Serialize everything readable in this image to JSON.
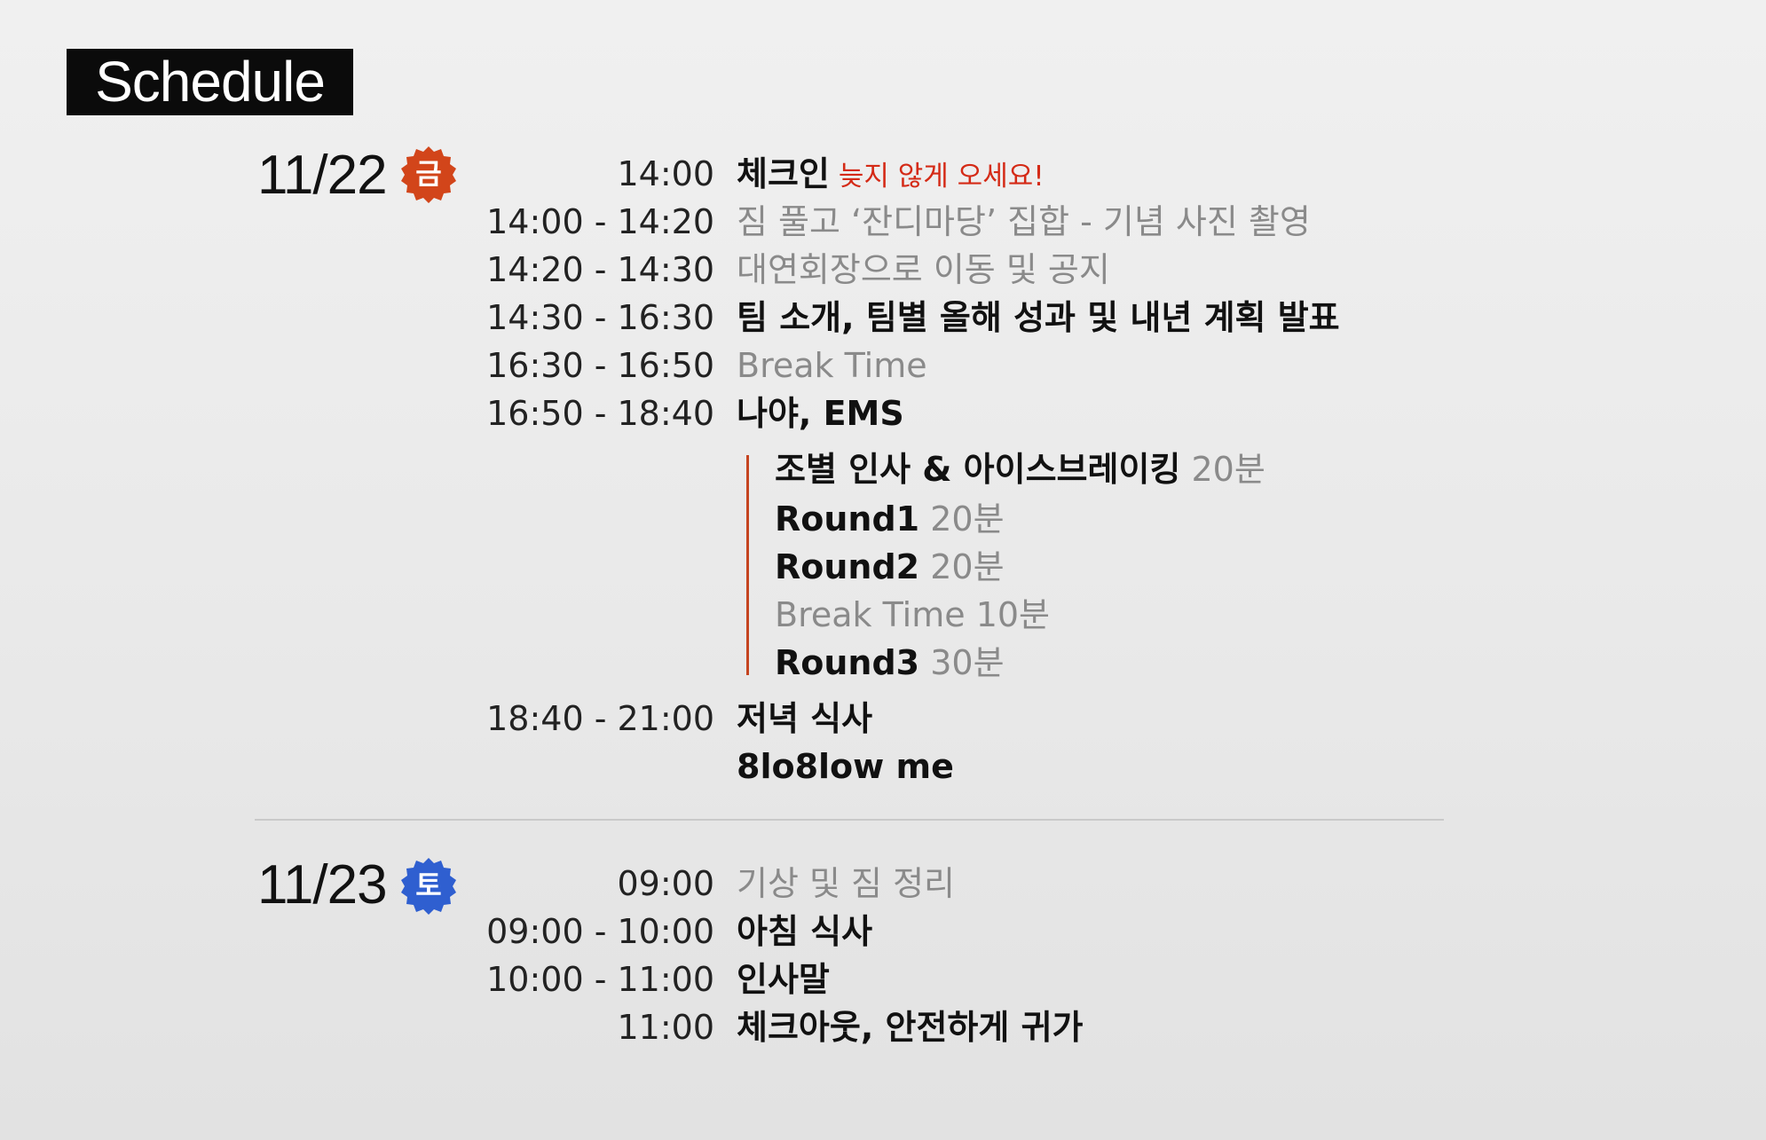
{
  "title": "Schedule",
  "day1": {
    "date": "11/22",
    "weekday": "금",
    "badge_color": "#d2451a",
    "items": [
      {
        "time": "14:00",
        "event": "체크인",
        "note": "늦지 않게 오세요!"
      },
      {
        "time": "14:00 - 14:20",
        "event": "짐 풀고 ‘잔디마당’ 집합 - 기념 사진 촬영"
      },
      {
        "time": "14:20 - 14:30",
        "event": "대연회장으로 이동 및 공지"
      },
      {
        "time": "14:30 - 16:30",
        "event": "팀 소개, 팀별 올해 성과 및 내년 계획 발표"
      },
      {
        "time": "16:30 - 16:50",
        "event": "Break Time"
      },
      {
        "time": "16:50 - 18:40",
        "event": "나야, EMS"
      }
    ],
    "sub_items": [
      {
        "label": "조별 인사 & 아이스브레이킹",
        "duration": "20분"
      },
      {
        "label": "Round1",
        "duration": "20분"
      },
      {
        "label": "Round2",
        "duration": "20분"
      },
      {
        "label": "Break Time",
        "duration": "10분"
      },
      {
        "label": "Round3",
        "duration": "30분"
      }
    ],
    "dinner": {
      "time": "18:40 - 21:00",
      "event": "저녁 식사",
      "place": "8lo8low me"
    }
  },
  "day2": {
    "date": "11/23",
    "weekday": "토",
    "badge_color": "#2f5fd0",
    "items": [
      {
        "time": "09:00",
        "event": "기상 및 짐 정리"
      },
      {
        "time": "09:00 - 10:00",
        "event": "아침 식사"
      },
      {
        "time": "10:00 - 11:00",
        "event": "인사말"
      },
      {
        "time": "11:00",
        "event": "체크아웃, 안전하게 귀가"
      }
    ]
  }
}
